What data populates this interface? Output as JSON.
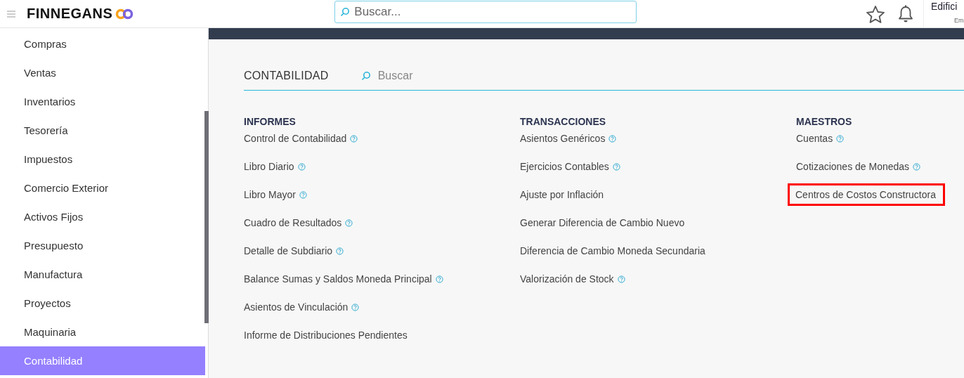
{
  "header": {
    "brand": "FINNEGANS",
    "search": {
      "placeholder": "Buscar..."
    },
    "user": {
      "name": "Edifici",
      "subtitle": "Em"
    }
  },
  "sidebar": {
    "items": [
      {
        "label": "Compras",
        "selected": false
      },
      {
        "label": "Ventas",
        "selected": false
      },
      {
        "label": "Inventarios",
        "selected": false
      },
      {
        "label": "Tesorería",
        "selected": false
      },
      {
        "label": "Impuestos",
        "selected": false
      },
      {
        "label": "Comercio Exterior",
        "selected": false
      },
      {
        "label": "Activos Fijos",
        "selected": false
      },
      {
        "label": "Presupuesto",
        "selected": false
      },
      {
        "label": "Manufactura",
        "selected": false
      },
      {
        "label": "Proyectos",
        "selected": false
      },
      {
        "label": "Maquinaria",
        "selected": false
      },
      {
        "label": "Contabilidad",
        "selected": true
      }
    ]
  },
  "module": {
    "title": "CONTABILIDAD",
    "search": {
      "placeholder": "Buscar"
    },
    "columns": [
      {
        "heading": "INFORMES",
        "items": [
          {
            "label": "Control de Contabilidad",
            "help": true,
            "highlighted": false
          },
          {
            "label": "Libro Diario",
            "help": true,
            "highlighted": false
          },
          {
            "label": "Libro Mayor",
            "help": true,
            "highlighted": false
          },
          {
            "label": "Cuadro de Resultados",
            "help": true,
            "highlighted": false
          },
          {
            "label": "Detalle de Subdiario",
            "help": true,
            "highlighted": false
          },
          {
            "label": "Balance Sumas y Saldos Moneda Principal",
            "help": true,
            "highlighted": false
          },
          {
            "label": "Asientos de Vinculación",
            "help": true,
            "highlighted": false
          },
          {
            "label": "Informe de Distribuciones Pendientes",
            "help": false,
            "highlighted": false
          }
        ]
      },
      {
        "heading": "TRANSACCIONES",
        "items": [
          {
            "label": "Asientos Genéricos",
            "help": true,
            "highlighted": false
          },
          {
            "label": "Ejercicios Contables",
            "help": true,
            "highlighted": false
          },
          {
            "label": "Ajuste por Inflación",
            "help": false,
            "highlighted": false
          },
          {
            "label": "Generar Diferencia de Cambio Nuevo",
            "help": false,
            "highlighted": false
          },
          {
            "label": "Diferencia de Cambio Moneda Secundaria",
            "help": false,
            "highlighted": false
          },
          {
            "label": "Valorización de Stock",
            "help": true,
            "highlighted": false
          }
        ]
      },
      {
        "heading": "MAESTROS",
        "items": [
          {
            "label": "Cuentas",
            "help": true,
            "highlighted": false
          },
          {
            "label": "Cotizaciones de Monedas",
            "help": true,
            "highlighted": false
          },
          {
            "label": "Centros de Costos Constructora",
            "help": false,
            "highlighted": true
          }
        ]
      }
    ]
  }
}
